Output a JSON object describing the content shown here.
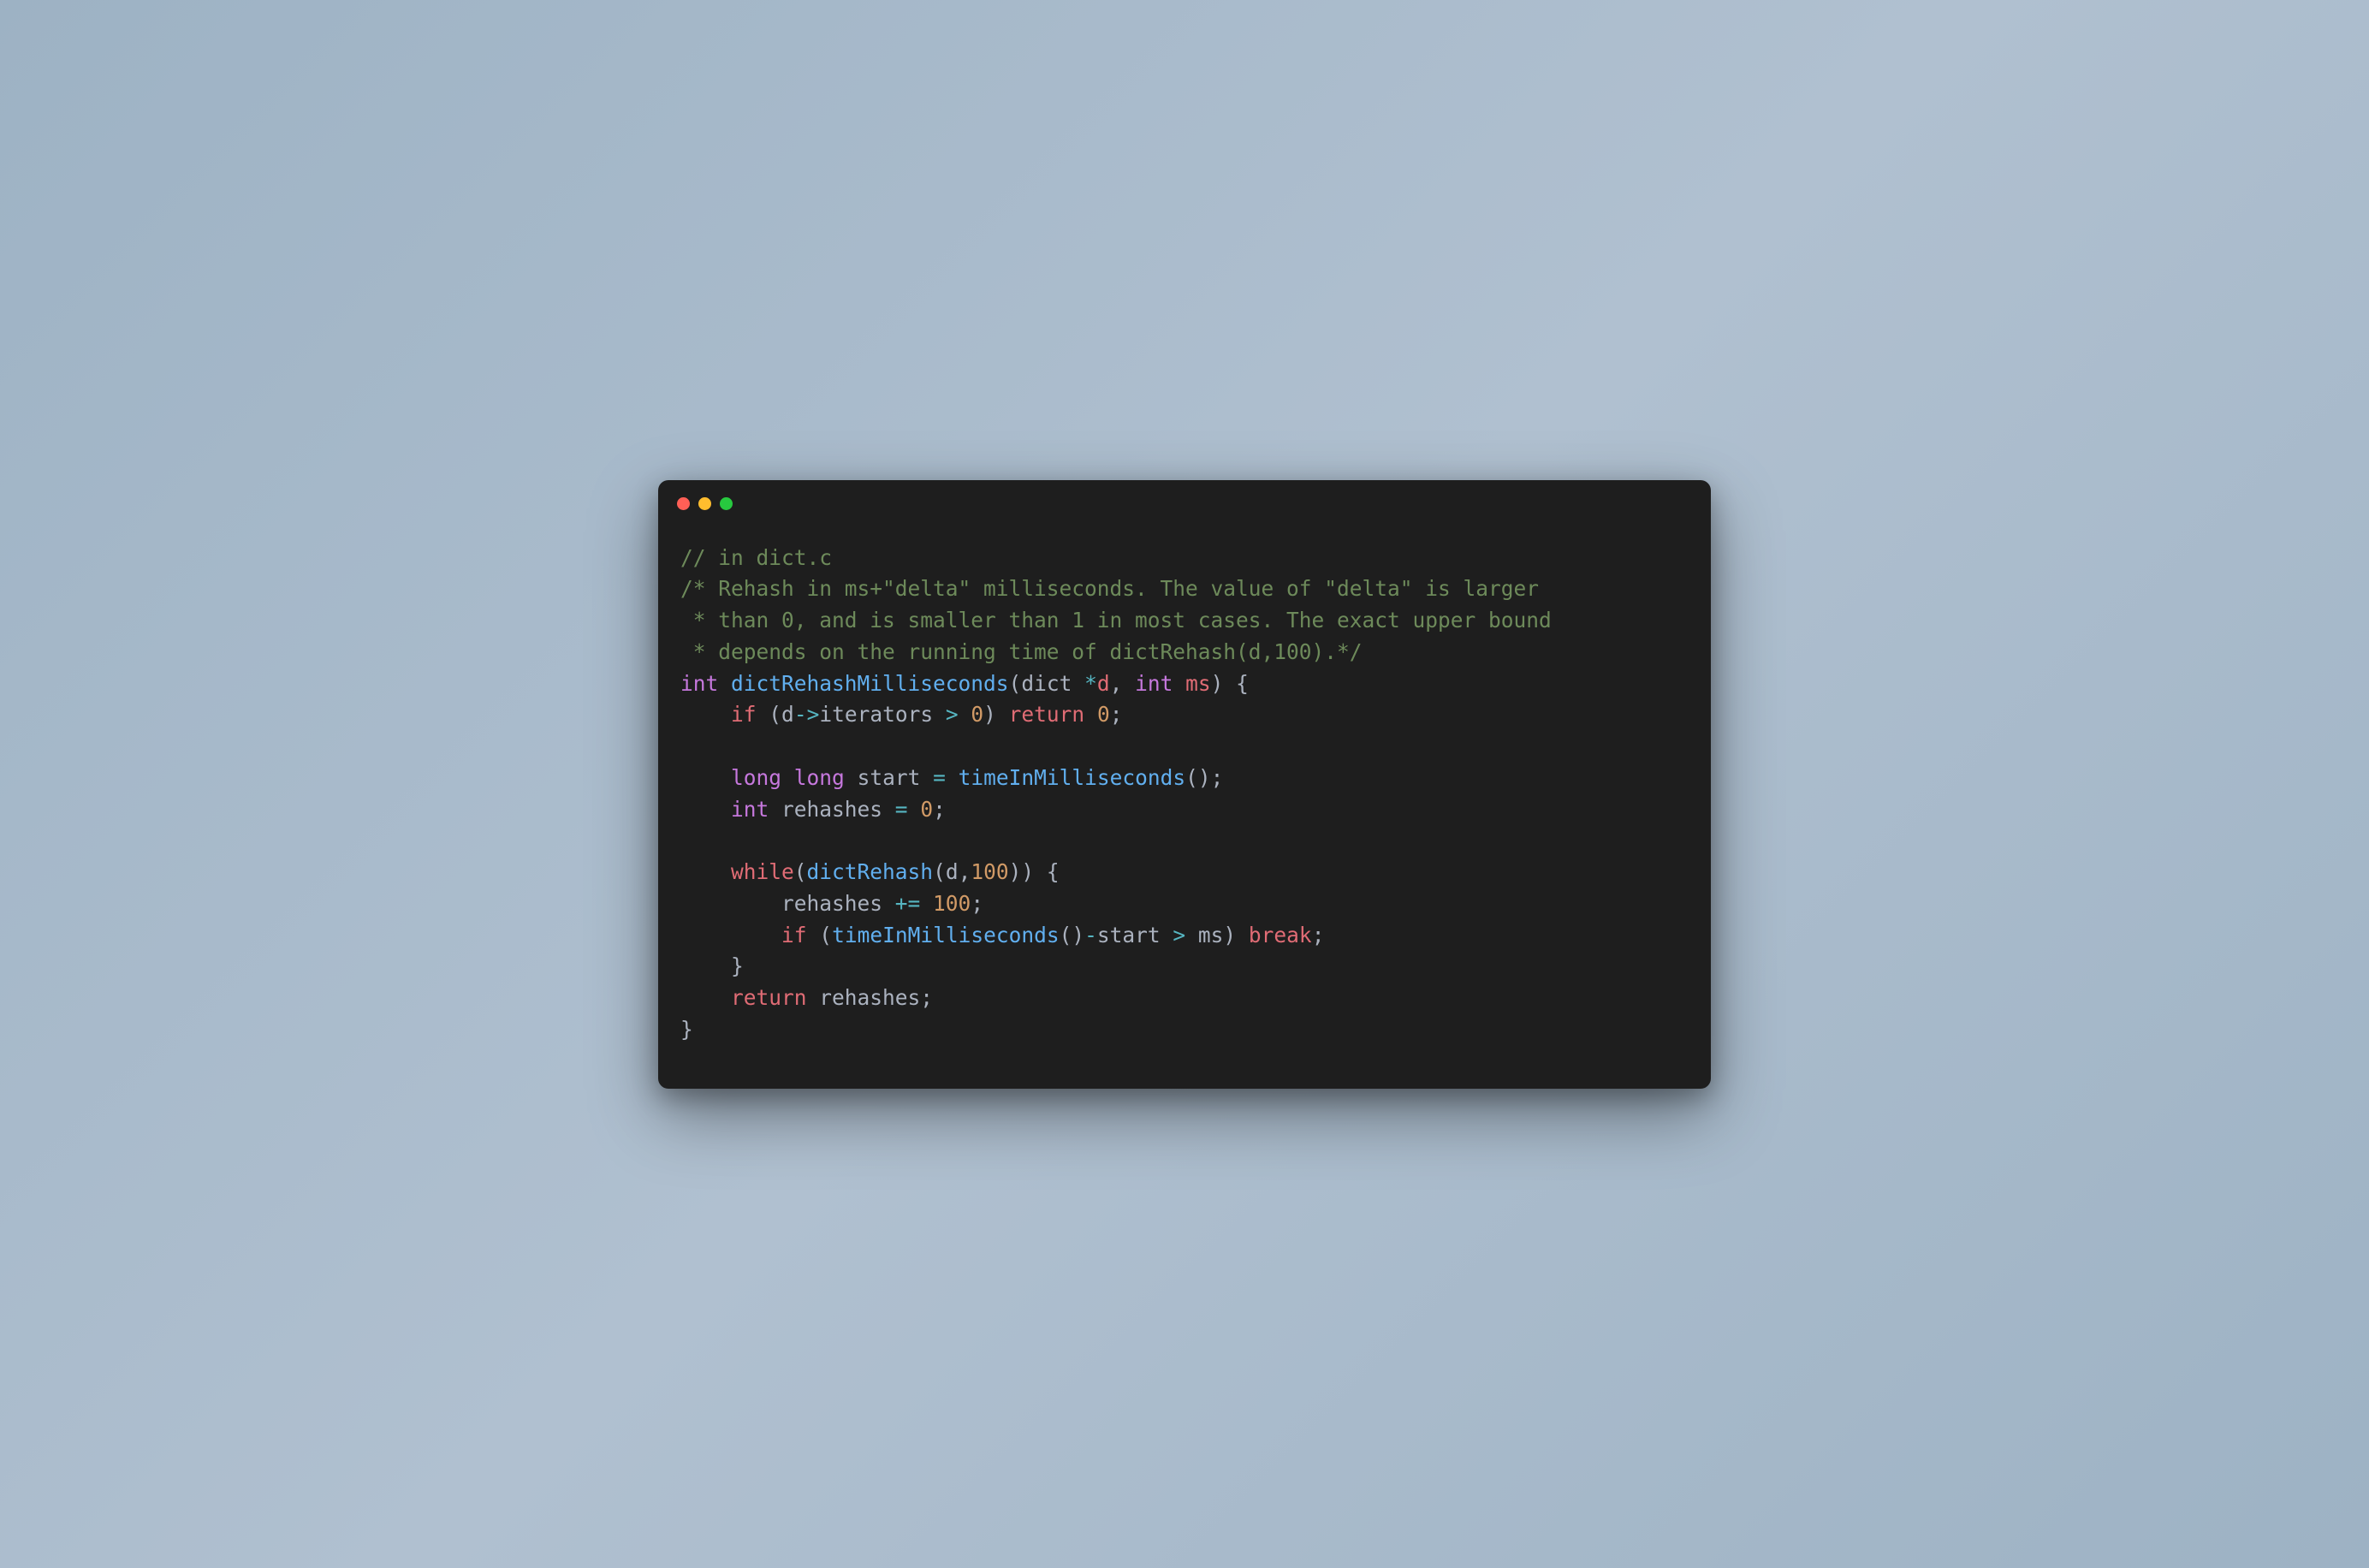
{
  "window": {
    "traffic_lights": [
      "close",
      "minimize",
      "maximize"
    ]
  },
  "code": {
    "lines": [
      [
        {
          "cls": "tok-comment",
          "text": "// in dict.c"
        }
      ],
      [
        {
          "cls": "tok-comment",
          "text": "/* Rehash in ms+\"delta\" milliseconds. The value of \"delta\" is larger"
        }
      ],
      [
        {
          "cls": "tok-comment",
          "text": " * than 0, and is smaller than 1 in most cases. The exact upper bound"
        }
      ],
      [
        {
          "cls": "tok-comment",
          "text": " * depends on the running time of dictRehash(d,100).*/"
        }
      ],
      [
        {
          "cls": "tok-type",
          "text": "int"
        },
        {
          "cls": "tok-ident",
          "text": " "
        },
        {
          "cls": "tok-function",
          "text": "dictRehashMilliseconds"
        },
        {
          "cls": "tok-punct",
          "text": "("
        },
        {
          "cls": "tok-ident",
          "text": "dict "
        },
        {
          "cls": "tok-operator",
          "text": "*"
        },
        {
          "cls": "tok-param",
          "text": "d"
        },
        {
          "cls": "tok-punct",
          "text": ", "
        },
        {
          "cls": "tok-type",
          "text": "int"
        },
        {
          "cls": "tok-ident",
          "text": " "
        },
        {
          "cls": "tok-param",
          "text": "ms"
        },
        {
          "cls": "tok-punct",
          "text": ") {"
        }
      ],
      [
        {
          "cls": "tok-ident",
          "text": "    "
        },
        {
          "cls": "tok-keyword",
          "text": "if"
        },
        {
          "cls": "tok-ident",
          "text": " "
        },
        {
          "cls": "tok-punct",
          "text": "(d"
        },
        {
          "cls": "tok-operator",
          "text": "->"
        },
        {
          "cls": "tok-ident",
          "text": "iterators "
        },
        {
          "cls": "tok-operator",
          "text": ">"
        },
        {
          "cls": "tok-ident",
          "text": " "
        },
        {
          "cls": "tok-number",
          "text": "0"
        },
        {
          "cls": "tok-punct",
          "text": ") "
        },
        {
          "cls": "tok-keyword",
          "text": "return"
        },
        {
          "cls": "tok-ident",
          "text": " "
        },
        {
          "cls": "tok-number",
          "text": "0"
        },
        {
          "cls": "tok-punct",
          "text": ";"
        }
      ],
      [
        {
          "cls": "tok-ident",
          "text": ""
        }
      ],
      [
        {
          "cls": "tok-ident",
          "text": "    "
        },
        {
          "cls": "tok-type",
          "text": "long"
        },
        {
          "cls": "tok-ident",
          "text": " "
        },
        {
          "cls": "tok-type",
          "text": "long"
        },
        {
          "cls": "tok-ident",
          "text": " start "
        },
        {
          "cls": "tok-operator",
          "text": "="
        },
        {
          "cls": "tok-ident",
          "text": " "
        },
        {
          "cls": "tok-function",
          "text": "timeInMilliseconds"
        },
        {
          "cls": "tok-punct",
          "text": "();"
        }
      ],
      [
        {
          "cls": "tok-ident",
          "text": "    "
        },
        {
          "cls": "tok-type",
          "text": "int"
        },
        {
          "cls": "tok-ident",
          "text": " rehashes "
        },
        {
          "cls": "tok-operator",
          "text": "="
        },
        {
          "cls": "tok-ident",
          "text": " "
        },
        {
          "cls": "tok-number",
          "text": "0"
        },
        {
          "cls": "tok-punct",
          "text": ";"
        }
      ],
      [
        {
          "cls": "tok-ident",
          "text": ""
        }
      ],
      [
        {
          "cls": "tok-ident",
          "text": "    "
        },
        {
          "cls": "tok-keyword",
          "text": "while"
        },
        {
          "cls": "tok-punct",
          "text": "("
        },
        {
          "cls": "tok-function",
          "text": "dictRehash"
        },
        {
          "cls": "tok-punct",
          "text": "(d,"
        },
        {
          "cls": "tok-number",
          "text": "100"
        },
        {
          "cls": "tok-punct",
          "text": ")) {"
        }
      ],
      [
        {
          "cls": "tok-ident",
          "text": "        rehashes "
        },
        {
          "cls": "tok-operator",
          "text": "+="
        },
        {
          "cls": "tok-ident",
          "text": " "
        },
        {
          "cls": "tok-number",
          "text": "100"
        },
        {
          "cls": "tok-punct",
          "text": ";"
        }
      ],
      [
        {
          "cls": "tok-ident",
          "text": "        "
        },
        {
          "cls": "tok-keyword",
          "text": "if"
        },
        {
          "cls": "tok-ident",
          "text": " "
        },
        {
          "cls": "tok-punct",
          "text": "("
        },
        {
          "cls": "tok-function",
          "text": "timeInMilliseconds"
        },
        {
          "cls": "tok-punct",
          "text": "()"
        },
        {
          "cls": "tok-operator",
          "text": "-"
        },
        {
          "cls": "tok-ident",
          "text": "start "
        },
        {
          "cls": "tok-operator",
          "text": ">"
        },
        {
          "cls": "tok-ident",
          "text": " ms"
        },
        {
          "cls": "tok-punct",
          "text": ") "
        },
        {
          "cls": "tok-keyword",
          "text": "break"
        },
        {
          "cls": "tok-punct",
          "text": ";"
        }
      ],
      [
        {
          "cls": "tok-ident",
          "text": "    }"
        }
      ],
      [
        {
          "cls": "tok-ident",
          "text": "    "
        },
        {
          "cls": "tok-keyword",
          "text": "return"
        },
        {
          "cls": "tok-ident",
          "text": " rehashes"
        },
        {
          "cls": "tok-punct",
          "text": ";"
        }
      ],
      [
        {
          "cls": "tok-punct",
          "text": "}"
        }
      ]
    ]
  }
}
